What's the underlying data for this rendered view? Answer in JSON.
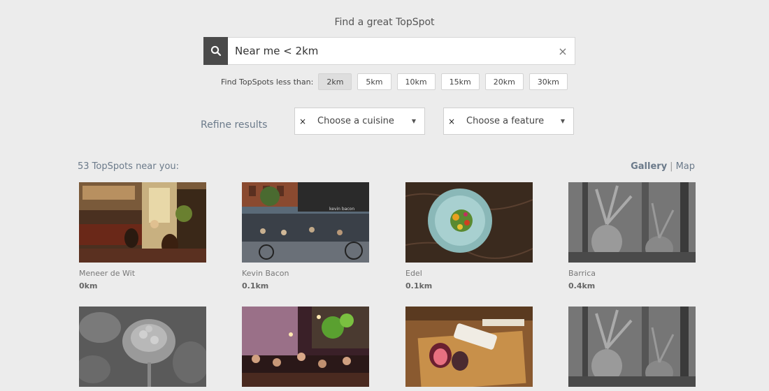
{
  "header": {
    "title": "Find a great TopSpot"
  },
  "search": {
    "value": "Near me < 2km",
    "clear_icon": "×"
  },
  "distance": {
    "label": "Find TopSpots less than:",
    "options": [
      "2km",
      "5km",
      "10km",
      "15km",
      "20km",
      "30km"
    ],
    "selected": "2km"
  },
  "refine": {
    "label": "Refine results",
    "cuisine": {
      "clear": "×",
      "placeholder": "Choose a cuisine",
      "caret": "▼"
    },
    "feature": {
      "clear": "×",
      "placeholder": "Choose a feature",
      "caret": "▼"
    }
  },
  "results": {
    "count_text": "53 TopSpots near you:",
    "view": {
      "gallery": "Gallery",
      "separator": "|",
      "map": "Map",
      "active": "Gallery"
    }
  },
  "spots": [
    {
      "name": "Meneer de Wit",
      "distance": "0km",
      "image": "warm-restaurant-interior"
    },
    {
      "name": "Kevin Bacon",
      "distance": "0.1km",
      "image": "street-terrace"
    },
    {
      "name": "Edel",
      "distance": "0.1km",
      "image": "plated-dish"
    },
    {
      "name": "Barrica",
      "distance": "0.4km",
      "image": "grayscale-plants"
    },
    {
      "name": "",
      "distance": "",
      "image": "grayscale-flower"
    },
    {
      "name": "",
      "distance": "",
      "image": "evening-bar"
    },
    {
      "name": "",
      "distance": "",
      "image": "figs-cutting-board"
    },
    {
      "name": "",
      "distance": "",
      "image": "grayscale-plants"
    }
  ],
  "colors": {
    "background": "#ececec",
    "search_button": "#4a4a4a",
    "muted_blue_text": "#6b7a8a"
  }
}
